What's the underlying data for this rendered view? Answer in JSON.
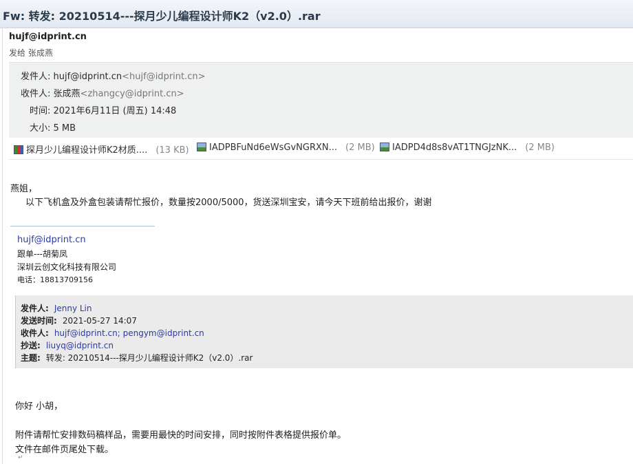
{
  "window": {
    "title": "Fw: 转发: 20210514---探月少儿编程设计师K2（v2.0）.rar"
  },
  "header": {
    "sender": "hujf@idprint.cn",
    "sent_to": "发给 张成燕"
  },
  "meta": {
    "from_label": "发件人:",
    "from_name": "hujf@idprint.cn",
    "from_addr": "<hujf@idprint.cn>",
    "to_label": "收件人:",
    "to_name": "张成燕",
    "to_addr": "<zhangcy@idprint.cn>",
    "time_label": "时间:",
    "time_value": "2021年6月11日 (周五) 14:48",
    "size_label": "大小:",
    "size_value": "5 MB"
  },
  "attachments": [
    {
      "name": "探月少儿编程设计师K2材质....",
      "size": "(13 KB)",
      "icon": "rar-archive-icon"
    },
    {
      "name": "IADPBFuNd6eWsGvNGRXN...",
      "size": "(2 MB)",
      "icon": "image-file-icon"
    },
    {
      "name": "IADPD4d8s8vAT1TNGJzNK...",
      "size": "(2 MB)",
      "icon": "image-file-icon"
    }
  ],
  "body": {
    "greeting": "燕姐，",
    "message": "以下飞机盒及外盒包装请帮忙报价，数量按2000/5000，货送深圳宝安，请今天下班前给出报价，谢谢"
  },
  "signature": {
    "email": "hujf@idprint.cn",
    "role": "跟单---胡菊凤",
    "company": "深圳云创文化科技有限公司",
    "phone": "电话：18813709156"
  },
  "quoted": {
    "from_label": "发件人:",
    "from_value": "Jenny Lin",
    "sent_label": "发送时间:",
    "sent_value": "2021-05-27 14:07",
    "to_label": "收件人:",
    "to_value": "hujf@idprint.cn; pengym@idprint.cn",
    "cc_label": "抄送:",
    "cc_value": "liuyq@idprint.cn",
    "subject_label": "主题:",
    "subject_value": "转发: 20210514---探月少儿编程设计师K2（v2.0）.rar"
  },
  "quoted_body": {
    "greeting": "你好 小胡，",
    "line1": "附件请帮忙安排数码稿样品，需要用最快的时间安排，同时按附件表格提供报价单。",
    "line2": "文件在邮件页尾处下载。",
    "end_mark": "↵"
  }
}
